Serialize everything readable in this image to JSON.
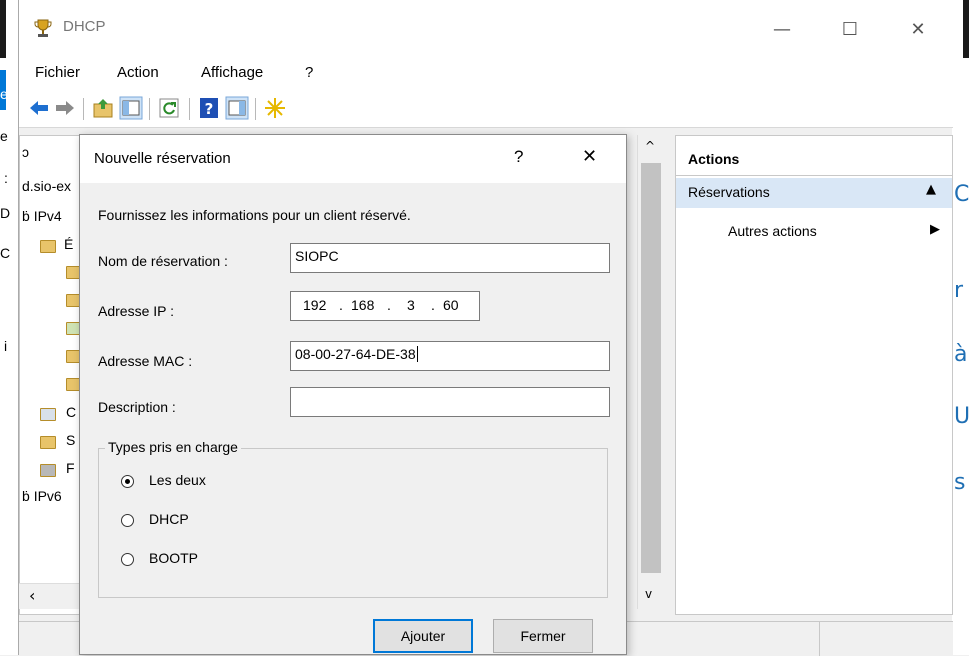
{
  "window": {
    "title": "DHCP",
    "icon": "dhcp-trophy-icon"
  },
  "menu": [
    "Fichier",
    "Action",
    "Affichage",
    "?"
  ],
  "toolbar_icons": [
    "back-arrow-icon",
    "forward-arrow-icon",
    "up-folder-icon",
    "show-hide-tree-icon",
    "refresh-icon",
    "help-icon",
    "properties-icon",
    "star-icon"
  ],
  "tree": {
    "server": "d.sio-ex",
    "ipv4": "IPv4",
    "folder_letter": "É",
    "items_c": "C",
    "items_s": "S",
    "items_f": "F",
    "ipv6": "IPv6"
  },
  "left_edge_text": {
    "e": "e",
    "colon": ":",
    "d": "D",
    "c": "C",
    "i": "i"
  },
  "right_edge_text": [
    "C",
    "r",
    "à",
    "U",
    "s"
  ],
  "actions_pane": {
    "header": "Actions",
    "section": "Réservations",
    "item": "Autres actions"
  },
  "dialog": {
    "title": "Nouvelle réservation",
    "help": "?",
    "close": "✕",
    "intro": "Fournissez les informations pour un client réservé.",
    "name_label": "Nom de réservation :",
    "name_value": "SIOPC",
    "ip_label": "Adresse IP :",
    "ip_octets": [
      "192",
      "168",
      "3",
      "60"
    ],
    "mac_label": "Adresse MAC :",
    "mac_value": "08-00-27-64-DE-38",
    "desc_label": "Description :",
    "desc_value": "",
    "group_label": "Types pris en charge",
    "radios": [
      "Les deux",
      "DHCP",
      "BOOTP"
    ],
    "selected_radio": "Les deux",
    "add_button": "Ajouter",
    "close_button": "Fermer"
  },
  "colors": {
    "accent": "#0078d7",
    "selection": "#d9e7f6"
  }
}
